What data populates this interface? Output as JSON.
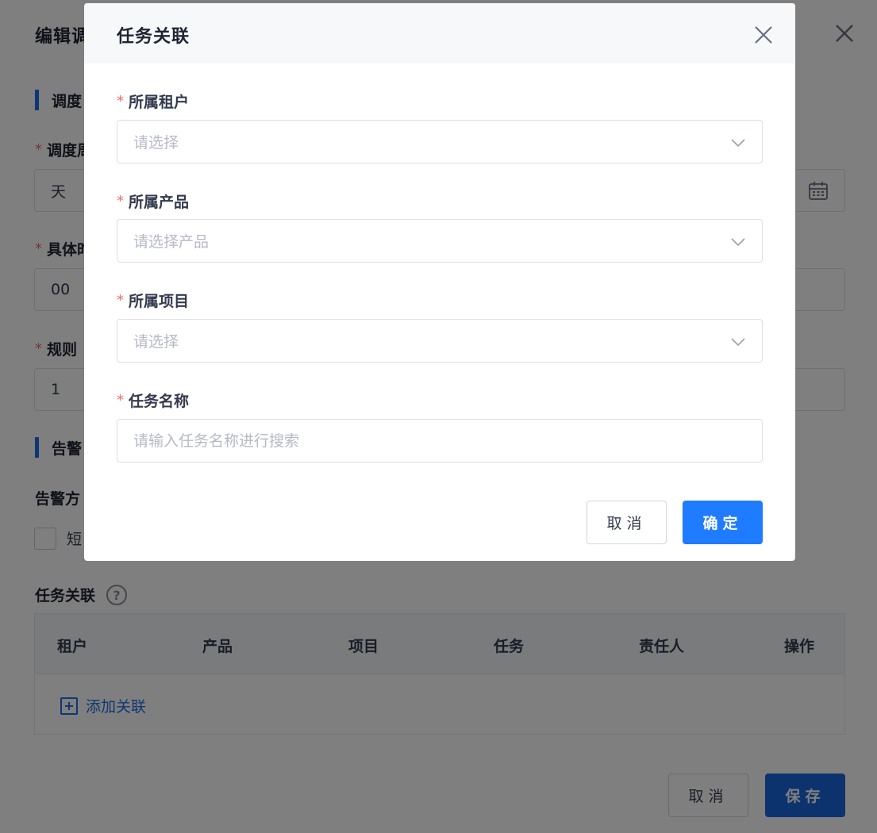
{
  "page": {
    "title": "编辑调",
    "sections": {
      "schedule": "调度",
      "alarm": "告警"
    },
    "fields": {
      "schedule_period_label": "调度周",
      "schedule_period_value": "天",
      "specific_time_label": "具体时",
      "specific_time_value": "00",
      "rule_label": "规则",
      "rule_value": "1",
      "alarm_method_label": "告警方",
      "sms_label": "短"
    },
    "task_link": {
      "label": "任务关联",
      "help_glyph": "?",
      "columns": [
        "租户",
        "产品",
        "项目",
        "任务",
        "责任人",
        "操作"
      ],
      "add_label": "添加关联"
    },
    "footer": {
      "cancel": "取消",
      "save": "保存"
    }
  },
  "modal": {
    "title": "任务关联",
    "fields": {
      "tenant": {
        "label": "所属租户",
        "placeholder": "请选择"
      },
      "product": {
        "label": "所属产品",
        "placeholder": "请选择产品"
      },
      "project": {
        "label": "所属项目",
        "placeholder": "请选择"
      },
      "task_name": {
        "label": "任务名称",
        "placeholder": "请输入任务名称进行搜索"
      }
    },
    "required_mark": "*",
    "buttons": {
      "cancel": "取消",
      "confirm": "确定"
    }
  },
  "colors": {
    "primary": "#1f7bff",
    "required": "#f56c6c",
    "section_bar": "#1f6fe6"
  },
  "icons": {
    "close": "close-icon",
    "chevron": "chevron-down-icon",
    "calendar": "calendar-icon",
    "help": "question-circle-icon",
    "add": "plus-square-icon"
  }
}
